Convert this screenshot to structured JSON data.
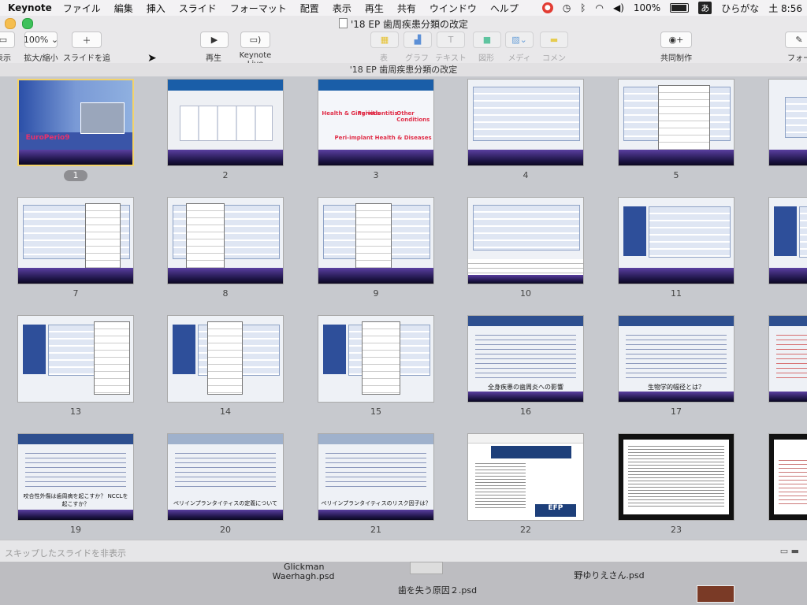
{
  "menubar": {
    "app": "Keynote",
    "items": [
      "ファイル",
      "編集",
      "挿入",
      "スライド",
      "フォーマット",
      "配置",
      "表示",
      "再生",
      "共有",
      "ウインドウ",
      "ヘルプ"
    ],
    "battery": "100%",
    "ime": "ひらがな",
    "ime_badge": "あ",
    "clock": "土 8:56"
  },
  "window": {
    "title": "'18 EP 歯周疾患分類の改定",
    "doc_bar": "'18 EP 歯周疾患分類の改定"
  },
  "toolbar": {
    "view_label": "表示",
    "zoom_value": "100%",
    "zoom_label": "拡大/縮小",
    "add_slide": "スライドを追加",
    "play": "再生",
    "keynote_live": "Keynote Live",
    "table": "表",
    "chart": "グラフ",
    "text": "テキスト",
    "shape": "図形",
    "media": "メディア",
    "comment": "コメント",
    "collaborate": "共同制作",
    "format": "フォー"
  },
  "slides": [
    {
      "number": "1"
    },
    {
      "number": "2"
    },
    {
      "number": "3"
    },
    {
      "number": "4"
    },
    {
      "number": "5"
    },
    {
      "number": "7"
    },
    {
      "number": "8"
    },
    {
      "number": "9"
    },
    {
      "number": "10"
    },
    {
      "number": "11"
    },
    {
      "number": "13"
    },
    {
      "number": "14"
    },
    {
      "number": "15"
    },
    {
      "number": "16"
    },
    {
      "number": "17"
    },
    {
      "number": "19"
    },
    {
      "number": "20"
    },
    {
      "number": "21"
    },
    {
      "number": "22"
    },
    {
      "number": "23"
    }
  ],
  "slide_text": {
    "s3_a": "Health & Gingivitis",
    "s3_b": "Periodontitis",
    "s3_c": "Other Conditions",
    "s3_d": "Peri-implant Health & Diseases",
    "s16": "全身疾患の歯周炎への影響",
    "s17": "生物学的幅径とは？",
    "s19": "咬合性外傷は歯周病を起こすか？ NCCLを起こすか？",
    "s20": "ペリインプランタイティスの定義について",
    "s21": "ペリインプランタイティスのリスク因子は？",
    "s22": "EFP"
  },
  "bottom": {
    "hide_skipped": "スキップしたスライドを非表示"
  },
  "desktop": {
    "file1": "Glickman",
    "file2": "Waerhagh.psd",
    "file3": "歯を失う原因２.psd",
    "file4": "野ゆりえさん.psd"
  }
}
